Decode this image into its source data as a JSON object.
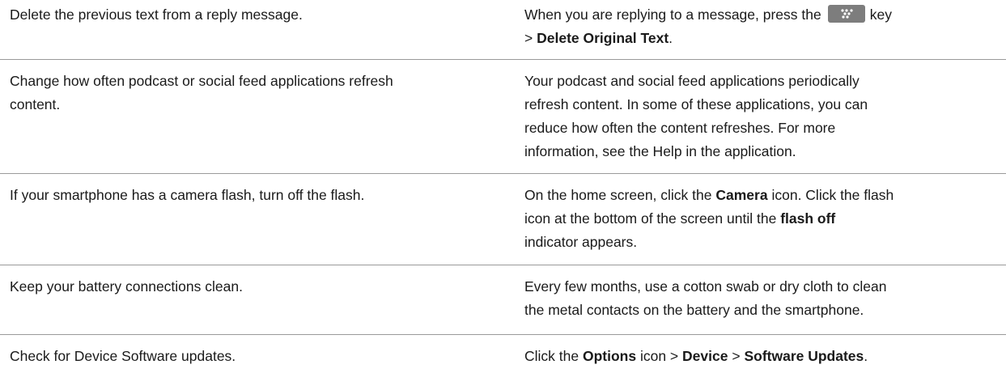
{
  "rows": [
    {
      "task": [
        "Delete the previous text from a reply message."
      ],
      "instruction": {
        "line1_pre": "When you are replying to a message, press the",
        "line1_post": "key",
        "line2_pre": ">",
        "line2_bold": "Delete Original Text",
        "line2_post": "."
      },
      "key_icon": "blackberry-menu-key-icon"
    },
    {
      "task": [
        "Change how often podcast or social feed applications refresh",
        "content."
      ],
      "instruction": [
        "Your podcast and social feed applications periodically",
        "refresh content. In some of these applications, you can",
        "reduce how often the content refreshes. For more",
        "information, see the Help in the application."
      ]
    },
    {
      "task": [
        "If your smartphone has a camera flash, turn off the flash."
      ],
      "instruction": {
        "l1_pre": "On the home screen, click the",
        "l1_bold": "Camera",
        "l1_post": "icon. Click the flash",
        "l2_pre": "icon at the bottom of the screen until the",
        "l2_bold": "flash off",
        "l3": "indicator appears."
      }
    },
    {
      "task": [
        "Keep your battery connections clean."
      ],
      "instruction": [
        "Every few months, use a cotton swab or dry cloth to clean",
        "the metal contacts on the battery and the smartphone."
      ]
    },
    {
      "task": [
        "Check for Device Software updates."
      ],
      "instruction": {
        "pre": "Click the",
        "b1": "Options",
        "mid1": "icon >",
        "b2": "Device",
        "mid2": ">",
        "b3": "Software Updates",
        "post": "."
      }
    }
  ]
}
